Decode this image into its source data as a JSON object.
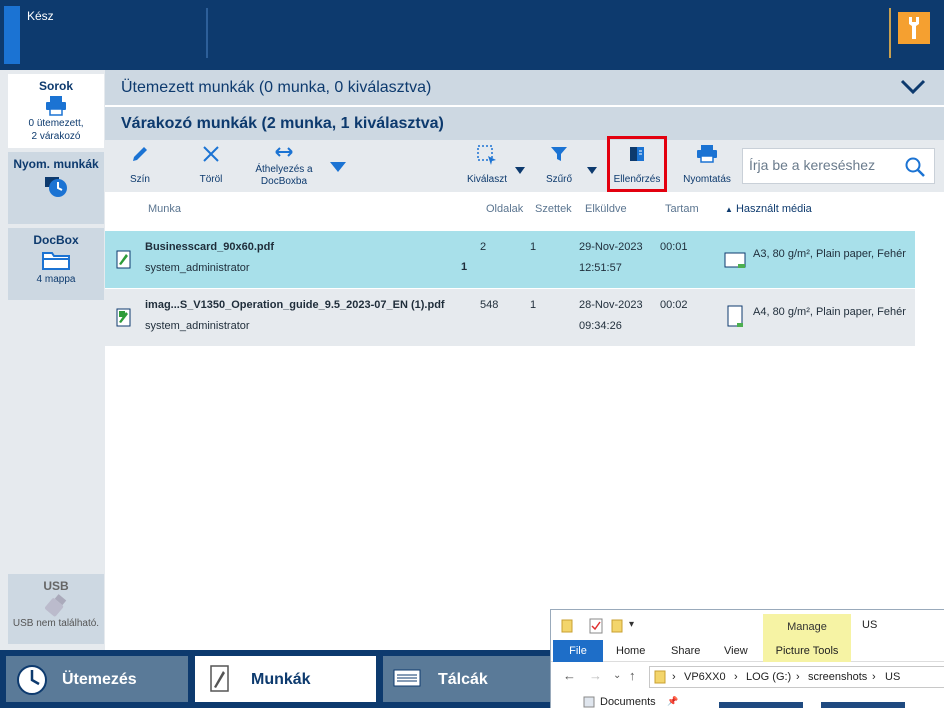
{
  "status": {
    "text": "Kész"
  },
  "colors": {
    "navy": "#0d3a6e",
    "accent": "#1b73d3",
    "selected_row": "#a8e0ea",
    "highlight": "#e3000f",
    "wrench_bg": "#f5a030"
  },
  "left_panel": {
    "sorok": {
      "title": "Sorok",
      "line1": "0 ütemezett,",
      "line2": "2 várakozó",
      "icon": "printer-queue-icon"
    },
    "nyom": {
      "title": "Nyom. munkák",
      "icon": "print-jobs-clock-icon"
    },
    "docbox": {
      "title": "DocBox",
      "sub": "4 mappa",
      "icon": "folder-icon"
    },
    "usb": {
      "title": "USB",
      "sub": "USB nem található.",
      "icon": "usb-icon"
    }
  },
  "main": {
    "scheduled_title": "Ütemezett munkák (0 munka, 0 kiválasztva)",
    "waiting_title": "Várakozó munkák (2 munka, 1 kiválasztva)"
  },
  "toolbar": {
    "szin": "Szín",
    "torol": "Töröl",
    "athelyezes_1": "Áthelyezés a",
    "athelyezes_2": "DocBoxba",
    "kivalaszt": "Kiválaszt",
    "szuro": "Szűrő",
    "ellenorzes": "Ellenőrzés",
    "nyomtatas": "Nyomtatás",
    "search_placeholder": "Írja be a kereséshez"
  },
  "columns": {
    "munka": "Munka",
    "oldalak": "Oldalak",
    "szettek": "Szettek",
    "elkuldve": "Elküldve",
    "tartam": "Tartam",
    "media": "Használt média"
  },
  "jobs": [
    {
      "name": "Businesscard_90x60.pdf",
      "owner": "system_administrator",
      "badge": "1",
      "pages": "2",
      "sets": "1",
      "date": "29-Nov-2023",
      "time": "12:51:57",
      "duration": "00:01",
      "media": "A3, 80 g/m², Plain paper, Fehér"
    },
    {
      "name": "imag...S_V1350_Operation_guide_9.5_2023-07_EN (1).pdf",
      "owner": "system_administrator",
      "badge": "",
      "pages": "548",
      "sets": "1",
      "date": "28-Nov-2023",
      "time": "09:34:26",
      "duration": "00:02",
      "media": "A4, 80 g/m², Plain paper, Fehér"
    }
  ],
  "bottom_tabs": {
    "utemezes": "Ütemezés",
    "munkak": "Munkák",
    "talcak": "Tálcák"
  },
  "explorer": {
    "manage": "Manage",
    "title": "US",
    "file": "File",
    "home": "Home",
    "share": "Share",
    "view": "View",
    "picture_tools": "Picture Tools",
    "crumbs": [
      "VP6XX0",
      "LOG (G:)",
      "screenshots",
      "US"
    ],
    "documents": "Documents"
  }
}
